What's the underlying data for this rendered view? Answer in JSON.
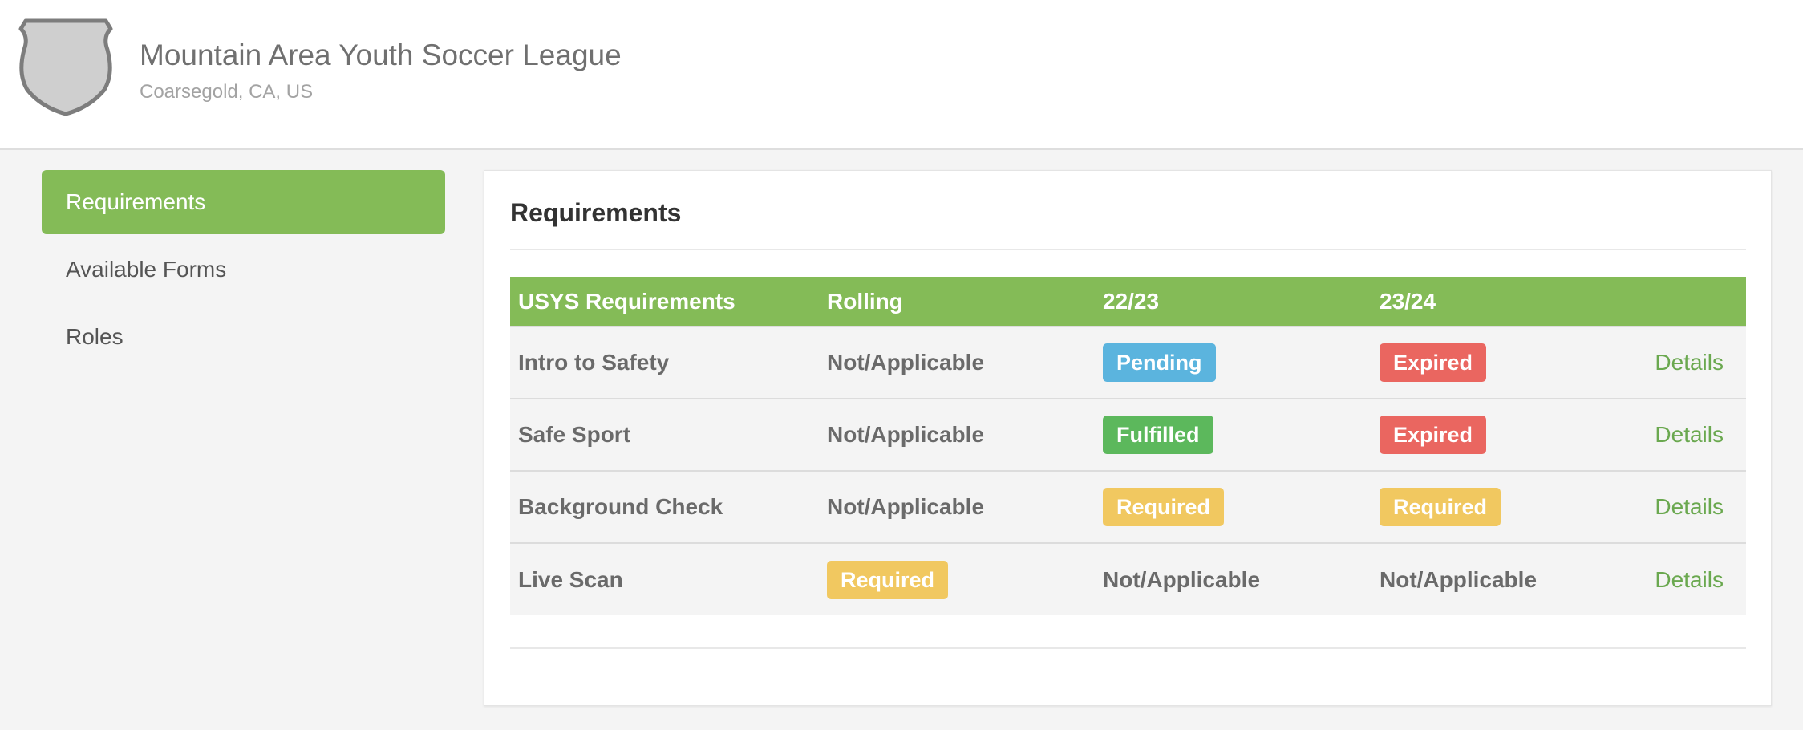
{
  "header": {
    "org_name": "Mountain Area Youth Soccer League",
    "location": "Coarsegold, CA, US",
    "logo_icon": "shield-icon"
  },
  "sidebar": {
    "items": [
      {
        "label": "Requirements",
        "active": true
      },
      {
        "label": "Available Forms",
        "active": false
      },
      {
        "label": "Roles",
        "active": false
      }
    ]
  },
  "main": {
    "title": "Requirements",
    "table": {
      "headers": [
        "USYS Requirements",
        "Rolling",
        "22/23",
        "23/24",
        ""
      ],
      "rows": [
        {
          "name": "Intro to Safety",
          "rolling": "Not/Applicable",
          "s2223": "Pending",
          "s2324": "Expired",
          "action": "Details"
        },
        {
          "name": "Safe Sport",
          "rolling": "Not/Applicable",
          "s2223": "Fulfilled",
          "s2324": "Expired",
          "action": "Details"
        },
        {
          "name": "Background Check",
          "rolling": "Not/Applicable",
          "s2223": "Required",
          "s2324": "Required",
          "action": "Details"
        },
        {
          "name": "Live Scan",
          "rolling": "Required",
          "s2223": "Not/Applicable",
          "s2324": "Not/Applicable",
          "action": "Details"
        }
      ]
    }
  },
  "colors": {
    "accent_green": "#84bb57",
    "pending_blue": "#5bb4de",
    "expired_red": "#ea6660",
    "fulfilled_green": "#5cb85c",
    "required_yellow": "#f1c860",
    "link_green": "#6aa84f"
  }
}
